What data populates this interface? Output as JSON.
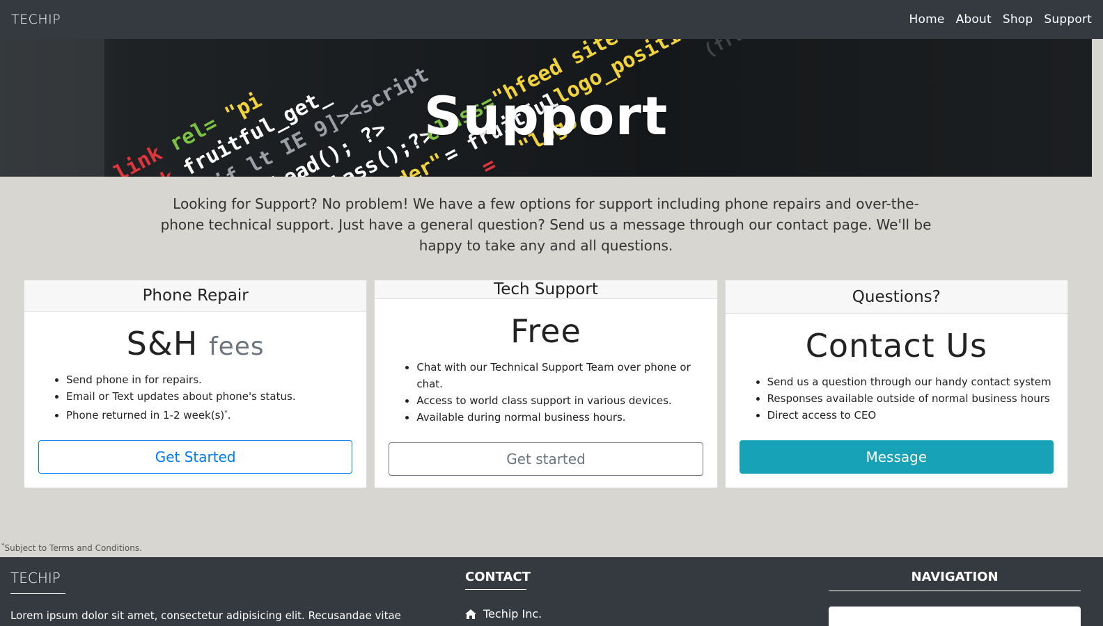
{
  "navbar": {
    "brand": "TECHIP",
    "links": [
      "Home",
      "About",
      "Shop",
      "Support"
    ]
  },
  "hero": {
    "title": "Support"
  },
  "intro": {
    "text": "Looking for Support? No problem! We have a few options for support including phone repairs and over-the-phone technical support. Just have a general question? Send us a message through our contact page. We'll be happy to take any and all questions."
  },
  "cards": [
    {
      "header": "Phone Repair",
      "price_main": "S&H",
      "price_sub": "fees",
      "items": [
        "Send phone in for repairs.",
        "Email or Text updates about phone's status.",
        "Phone returned in 1-2 week(s)"
      ],
      "item3_mark": "*",
      "item3_end": ".",
      "button": "Get Started"
    },
    {
      "header": "Tech Support",
      "price_main": "Free",
      "items": [
        "Chat with our Technical Support Team over phone or chat.",
        "Access to world class support in various devices.",
        "Available during normal business hours."
      ],
      "button": "Get started"
    },
    {
      "header": "Questions?",
      "price_main": "Contact Us",
      "items": [
        "Send us a question through our handy contact system",
        "Responses available outside of normal business hours",
        "Direct access to CEO"
      ],
      "button": "Message"
    }
  ],
  "footnote": {
    "mark": "*",
    "text": "Subject to Terms and Conditions."
  },
  "footer": {
    "brand": "TECHIP",
    "lorem": "Lorem ipsum dolor sit amet, consectetur adipisicing elit. Recusandae vitae",
    "contact_title": "CONTACT",
    "contact_item": "Techip Inc.",
    "contact_icon": "home-icon",
    "nav_title": "NAVIGATION"
  },
  "colors": {
    "navbar": "#343a40",
    "page_bg": "#d7d6d1",
    "primary": "#007bff",
    "secondary": "#6c757d",
    "info": "#17a2b8"
  }
}
